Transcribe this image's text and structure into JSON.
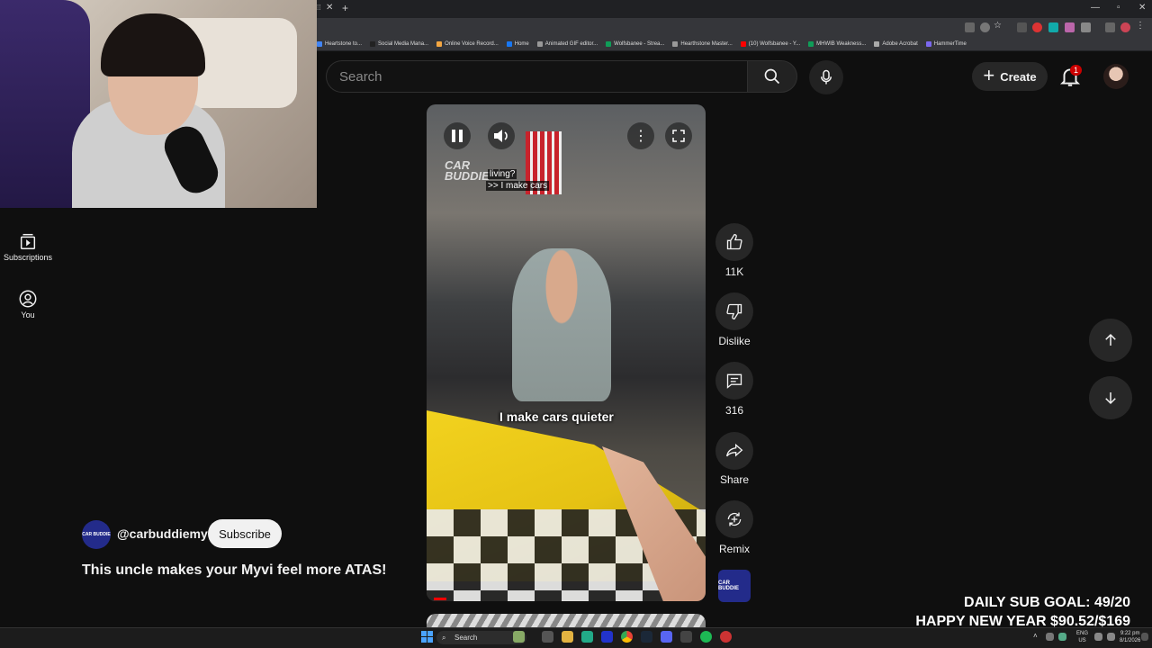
{
  "browser": {
    "bookmarks": [
      {
        "label": "Heartstone to...",
        "color": "#4285f4"
      },
      {
        "label": "Social Media Mana...",
        "color": "#222222"
      },
      {
        "label": "Online Voice Record...",
        "color": "#f4a742"
      },
      {
        "label": "Home",
        "color": "#1877f2"
      },
      {
        "label": "Animated GIF editor...",
        "color": "#999999"
      },
      {
        "label": "Wolfsbanee - Strea...",
        "color": "#0f9d58"
      },
      {
        "label": "Hearthstone Master...",
        "color": "#999999"
      },
      {
        "label": "(10) Wolfsbanee - Y...",
        "color": "#ff0000"
      },
      {
        "label": "MHWIB Weakness...",
        "color": "#0f9d58"
      },
      {
        "label": "Adobe Acrobat",
        "color": "#aaaaaa"
      },
      {
        "label": "HammerTime",
        "color": "#7b68ee"
      }
    ]
  },
  "header": {
    "search_placeholder": "Search",
    "create_label": "Create",
    "notification_count": "1"
  },
  "sidebar": {
    "items": [
      {
        "label": "Subscriptions",
        "icon": "subscriptions-icon"
      },
      {
        "label": "You",
        "icon": "user-circle-icon"
      }
    ]
  },
  "video": {
    "subtitle_question": "living?",
    "subtitle_answer": ">> I make cars",
    "watermark": "CAR BUDDIE",
    "caption": "I make cars quieter"
  },
  "actions": {
    "like_count": "11K",
    "dislike_label": "Dislike",
    "comment_count": "316",
    "share_label": "Share",
    "remix_label": "Remix"
  },
  "channel": {
    "handle": "@carbuddiemy",
    "subscribe_label": "Subscribe",
    "avatar_text": "CAR BUDDIE"
  },
  "short": {
    "title": "This uncle makes your Myvi feel more ATAS!"
  },
  "overlay": {
    "goal_line1": "DAILY SUB GOAL: 49/20",
    "goal_line2": "HAPPY NEW YEAR $90.52/$169"
  },
  "taskbar": {
    "search_label": "Search",
    "lang_line1": "ENG",
    "lang_line2": "US",
    "time": "9:22 pm",
    "date": "8/1/2026"
  },
  "colors": {
    "background": "#0f0f0f",
    "badge": "#cc0000"
  }
}
